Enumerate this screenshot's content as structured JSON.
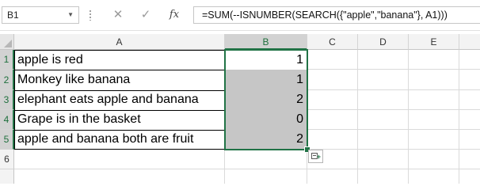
{
  "formula_bar": {
    "name_box": "B1",
    "cancel_icon": "✕",
    "enter_icon": "✓",
    "fx_label": "fx",
    "formula": "=SUM(--ISNUMBER(SEARCH({\"apple\",\"banana\"}, A1)))"
  },
  "columns": [
    "A",
    "B",
    "C",
    "D",
    "E"
  ],
  "rows": [
    "1",
    "2",
    "3",
    "4",
    "5",
    "6"
  ],
  "cells": {
    "A1": "apple is red",
    "A2": "Monkey like banana",
    "A3": "elephant eats apple and banana",
    "A4": "Grape is in the basket",
    "A5": "apple and banana both are fruit",
    "B1": "1",
    "B2": "1",
    "B3": "2",
    "B4": "0",
    "B5": "2"
  },
  "colors": {
    "accent": "#217346",
    "shaded_cell": "#c6c6c6"
  },
  "icons": {
    "quick_analysis": "quick-analysis-icon"
  }
}
